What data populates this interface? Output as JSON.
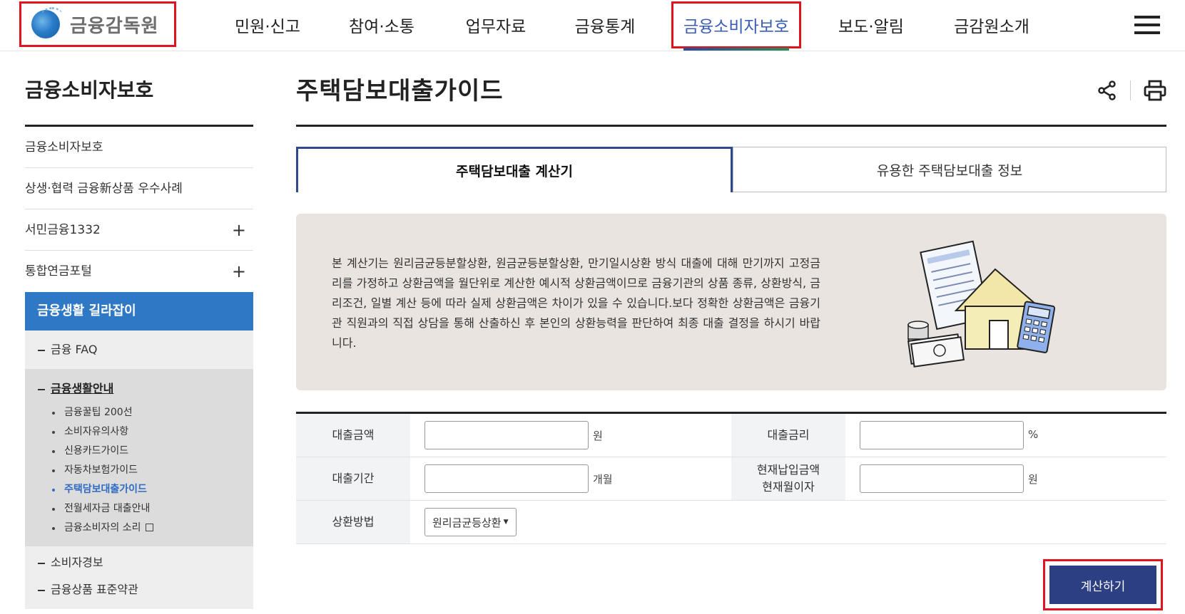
{
  "header": {
    "logo_text": "금융감독원",
    "nav": [
      "민원·신고",
      "참여·소통",
      "업무자료",
      "금융통계",
      "금융소비자보호",
      "보도·알림",
      "금감원소개"
    ],
    "active_nav": "금융소비자보호"
  },
  "sidebar": {
    "title": "금융소비자보호",
    "items": [
      {
        "label": "금융소비자보호",
        "expandable": false
      },
      {
        "label": "상생·협력 금융新상품 우수사례",
        "expandable": false
      },
      {
        "label": "서민금융1332",
        "expandable": true
      },
      {
        "label": "통합연금포털",
        "expandable": true
      }
    ],
    "active_section": "금융생활 길라잡이",
    "sub_items": {
      "faq": "금융 FAQ",
      "guide_head": "금융생활안내",
      "guide_leaves": [
        "금융꿀팁 200선",
        "소비자유의사항",
        "신용카드가이드",
        "자동차보험가이드",
        "주택담보대출가이드",
        "전월세자금 대출안내",
        "금융소비자의 소리"
      ],
      "current_leaf": "주택담보대출가이드",
      "alert": "소비자경보",
      "terms": "금융상품 표준약관"
    }
  },
  "main": {
    "title": "주택담보대출가이드",
    "tabs": [
      "주택담보대출 계산기",
      "유용한 주택담보대출 정보"
    ],
    "active_tab": 0,
    "info_text": "본 계산기는 원리금균등분할상환, 원금균등분할상환, 만기일시상환 방식 대출에 대해 만기까지 고정금리를 가정하고 상환금액을 월단위로 계산한 예시적 상환금액이므로 금융기관의 상품 종류, 상환방식, 금리조건, 일별 계산 등에 따라 실제 상환금액은 차이가 있을 수 있습니다.보다 정확한 상환금액은 금융기관 직원과의 직접 상담을 통해 산출하신 후 본인의 상환능력을 판단하여 최종 대출 결정을 하시기 바랍니다.",
    "form": {
      "loan_amount_label": "대출금액",
      "loan_amount_unit": "원",
      "loan_amount_value": "",
      "rate_label": "대출금리",
      "rate_unit": "%",
      "rate_value": "",
      "period_label": "대출기간",
      "period_unit": "개월",
      "period_value": "",
      "current_label_1": "현재납입금액",
      "current_label_2": "현재월이자",
      "current_unit": "원",
      "current_value": "",
      "method_label": "상환방법",
      "method_selected": "원리금균등상환"
    },
    "calc_button": "계산하기"
  },
  "colors": {
    "accent": "#2c3f83",
    "active_nav": "#3a5cb4",
    "sidebar_active": "#2f78c5",
    "highlight_box": "#e0141e"
  },
  "icons": [
    "share-icon",
    "print-icon",
    "menu-icon",
    "external-link-icon"
  ]
}
